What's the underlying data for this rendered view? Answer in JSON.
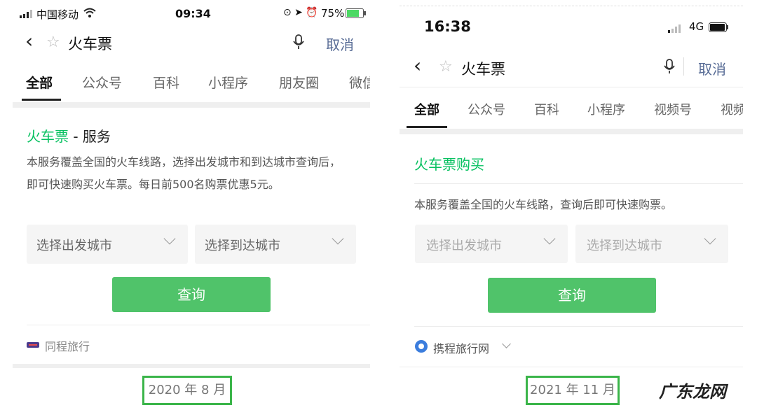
{
  "left": {
    "status": {
      "carrier": "中国移动",
      "time": "09:34",
      "battery": "75%"
    },
    "search": {
      "query": "火车票",
      "cancel": "取消"
    },
    "tabs": [
      "全部",
      "公众号",
      "百科",
      "小程序",
      "朋友圈",
      "微信"
    ],
    "card": {
      "title_green": "火车票",
      "title_rest": " - 服务",
      "description": "本服务覆盖全国的火车线路，选择出发城市和到达城市查询后，即可快速购买火车票。每日前500名购票优惠5元。",
      "select_from": "选择出发城市",
      "select_to": "选择到达城市",
      "button": "查询",
      "provider": "同程旅行"
    },
    "date_label": "2020 年 8 月"
  },
  "right": {
    "status": {
      "time": "16:38",
      "network": "4G"
    },
    "search": {
      "query": "火车票",
      "cancel": "取消"
    },
    "tabs": [
      "全部",
      "公众号",
      "百科",
      "小程序",
      "视频号",
      "视频"
    ],
    "card": {
      "title": "火车票购买",
      "description": "本服务覆盖全国的火车线路，查询后即可快速购票。",
      "select_from": "选择出发城市",
      "select_to": "选择到达城市",
      "button": "查询",
      "provider": "携程旅行网"
    },
    "date_label": "2021 年 11 月"
  },
  "watermark": "广东龙网",
  "colors": {
    "green": "#07c160",
    "button_green": "#50c36a",
    "link_blue": "#576b95",
    "date_border": "#3bb54a"
  }
}
